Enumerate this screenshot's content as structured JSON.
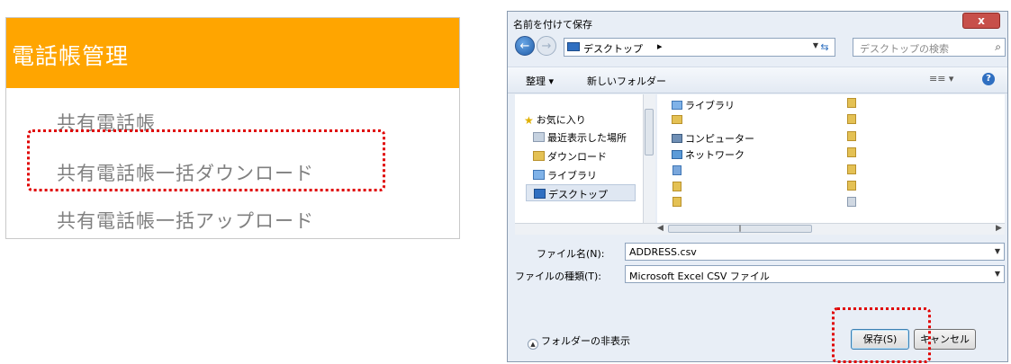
{
  "phonebook": {
    "title": "電話帳管理",
    "items": [
      {
        "label": "共有電話帳"
      },
      {
        "label": "共有電話帳一括ダウンロード",
        "highlighted": true
      },
      {
        "label": "共有電話帳一括アップロード"
      }
    ],
    "colors": {
      "header": "#ffa500",
      "highlight": "#e00000"
    }
  },
  "dialog": {
    "title": "名前を付けて保存",
    "close_label": "x",
    "address": {
      "path": "デスクトップ",
      "separator": "▸"
    },
    "search": {
      "placeholder": "デスクトップの検索"
    },
    "toolbar": {
      "organize": "整理 ▾",
      "new_folder": "新しいフォルダー",
      "views": "≡≡ ▾",
      "help": "?"
    },
    "nav_pane": [
      {
        "label": "お気に入り",
        "icon": "star-icon"
      },
      {
        "label": "最近表示した場所",
        "icon": "recent-places-icon"
      },
      {
        "label": "ダウンロード",
        "icon": "downloads-icon"
      },
      {
        "label": "ライブラリ",
        "icon": "library-icon"
      },
      {
        "label": "デスクトップ",
        "icon": "desktop-icon",
        "selected": true
      }
    ],
    "files": [
      {
        "label": "ライブラリ",
        "icon": "library-icon"
      },
      {
        "label": "",
        "icon": "user-folder-icon"
      },
      {
        "label": "コンピューター",
        "icon": "computer-icon"
      },
      {
        "label": "ネットワーク",
        "icon": "network-icon"
      }
    ],
    "filename_label": "ファイル名(N):",
    "filename_value": "ADDRESS.csv",
    "filetype_label": "ファイルの種類(T):",
    "filetype_value": "Microsoft Excel CSV ファイル",
    "hide_folders": "フォルダーの非表示",
    "save_button": "保存(S)",
    "cancel_button": "キャンセル"
  }
}
